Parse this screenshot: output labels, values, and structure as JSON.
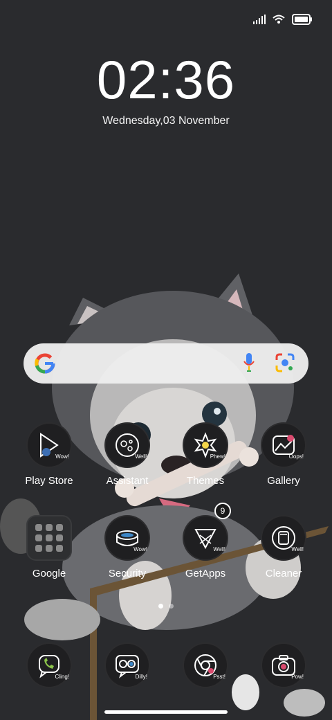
{
  "lockscreen": {
    "time": "02:36",
    "date": "Wednesday,03 November"
  },
  "search": {
    "placeholder": ""
  },
  "apps_row1": [
    {
      "label": "Play Store",
      "sticker": "Wow!"
    },
    {
      "label": "Assistant",
      "sticker": "Well!"
    },
    {
      "label": "Themes",
      "sticker": "Phew!"
    },
    {
      "label": "Gallery",
      "sticker": "Oops!"
    }
  ],
  "apps_row2": [
    {
      "label": "Google"
    },
    {
      "label": "Security",
      "sticker": "Wow!"
    },
    {
      "label": "GetApps",
      "sticker": "Well!",
      "badge": "9"
    },
    {
      "label": "Cleaner",
      "sticker": "Well!"
    }
  ],
  "dock": [
    {
      "name": "phone",
      "sticker": "Cling!"
    },
    {
      "name": "messages",
      "sticker": "Dilly!"
    },
    {
      "name": "browser",
      "sticker": "Psst!"
    },
    {
      "name": "camera",
      "sticker": "Pow!"
    }
  ],
  "colors": {
    "background": "#2a2b2e",
    "google_blue": "#4285F4",
    "google_red": "#EA4335",
    "google_yellow": "#FBBC05",
    "google_green": "#34A853"
  },
  "icons": [
    "signal-icon",
    "wifi-icon",
    "battery-icon",
    "google-g-icon",
    "microphone-icon",
    "lens-icon"
  ]
}
